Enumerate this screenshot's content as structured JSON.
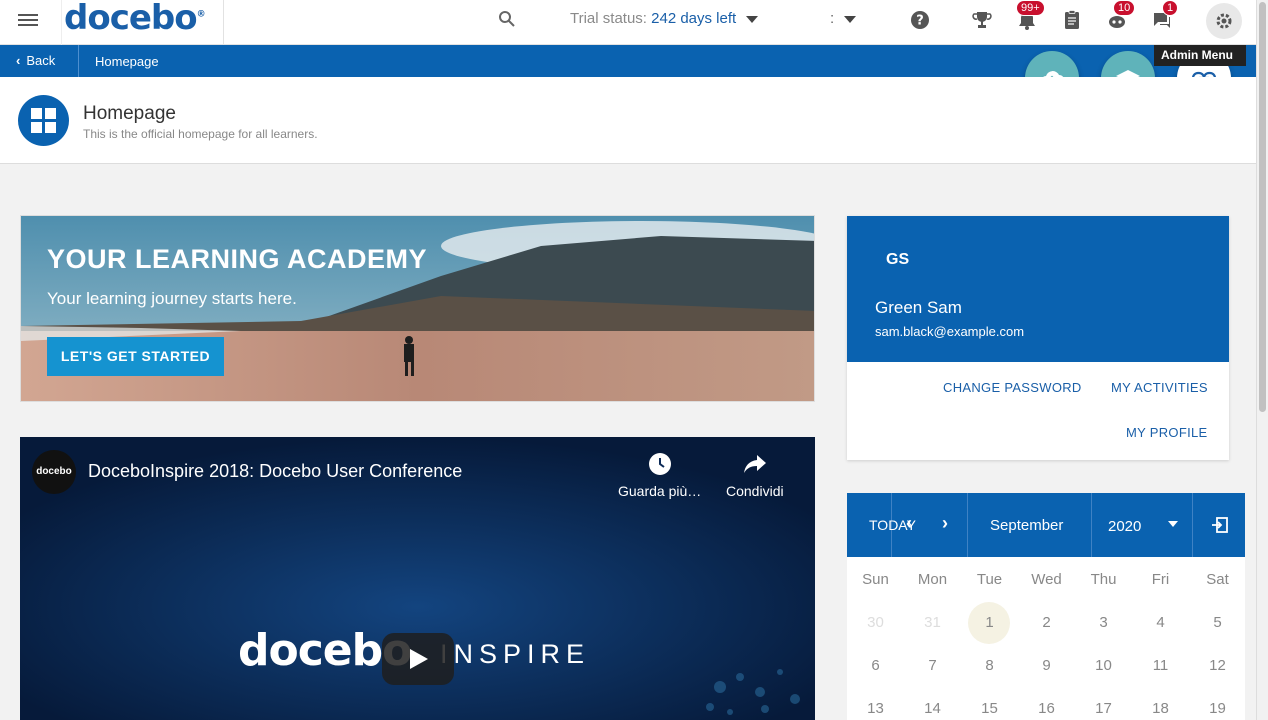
{
  "topbar": {
    "logo_text": "docebo",
    "logo_mark": "®",
    "trial_label": "Trial status:",
    "trial_days": "242 days left",
    "selector_value": ":",
    "badges": {
      "notifications": "99+",
      "gamification": "10",
      "messages": "1"
    },
    "icons": [
      "menu-icon",
      "search-icon",
      "help-icon",
      "trophy-icon",
      "bell-icon",
      "clipboard-icon",
      "robot-icon",
      "chat-icon",
      "gear-icon"
    ]
  },
  "breadcrumb": {
    "back_label": "Back",
    "current": "Homepage"
  },
  "tooltip": {
    "admin_menu": "Admin Menu"
  },
  "page": {
    "title": "Homepage",
    "subtitle": "This is the official homepage for all learners."
  },
  "banner": {
    "title": "YOUR LEARNING ACADEMY",
    "subtitle": "Your learning journey starts here.",
    "button_label": "LET'S GET STARTED"
  },
  "video": {
    "channel_label": "docebo",
    "title": "DoceboInspire 2018: Docebo User Conference",
    "watch_later": "Guarda più…",
    "share": "Condividi",
    "logo_text": "docebo",
    "inspire_text": "INSPIRE"
  },
  "profile": {
    "initials": "GS",
    "name": "Green Sam",
    "email": "sam.black@example.com",
    "change_password": "CHANGE PASSWORD",
    "my_activities": "MY ACTIVITIES",
    "my_profile": "MY PROFILE"
  },
  "calendar": {
    "today_label": "TODAY",
    "month": "September",
    "year": "2020",
    "weekdays": [
      "Sun",
      "Mon",
      "Tue",
      "Wed",
      "Thu",
      "Fri",
      "Sat"
    ],
    "rows": [
      [
        "30",
        "31",
        "1",
        "2",
        "3",
        "4",
        "5"
      ],
      [
        "6",
        "7",
        "8",
        "9",
        "10",
        "11",
        "12"
      ],
      [
        "13",
        "14",
        "15",
        "16",
        "17",
        "18",
        "19"
      ]
    ],
    "today_day": "1"
  },
  "colors": {
    "brand_blue": "#0a62b0",
    "accent_teal": "#5fb3ba",
    "badge_red": "#c8102e",
    "button_blue": "#1593d0"
  }
}
